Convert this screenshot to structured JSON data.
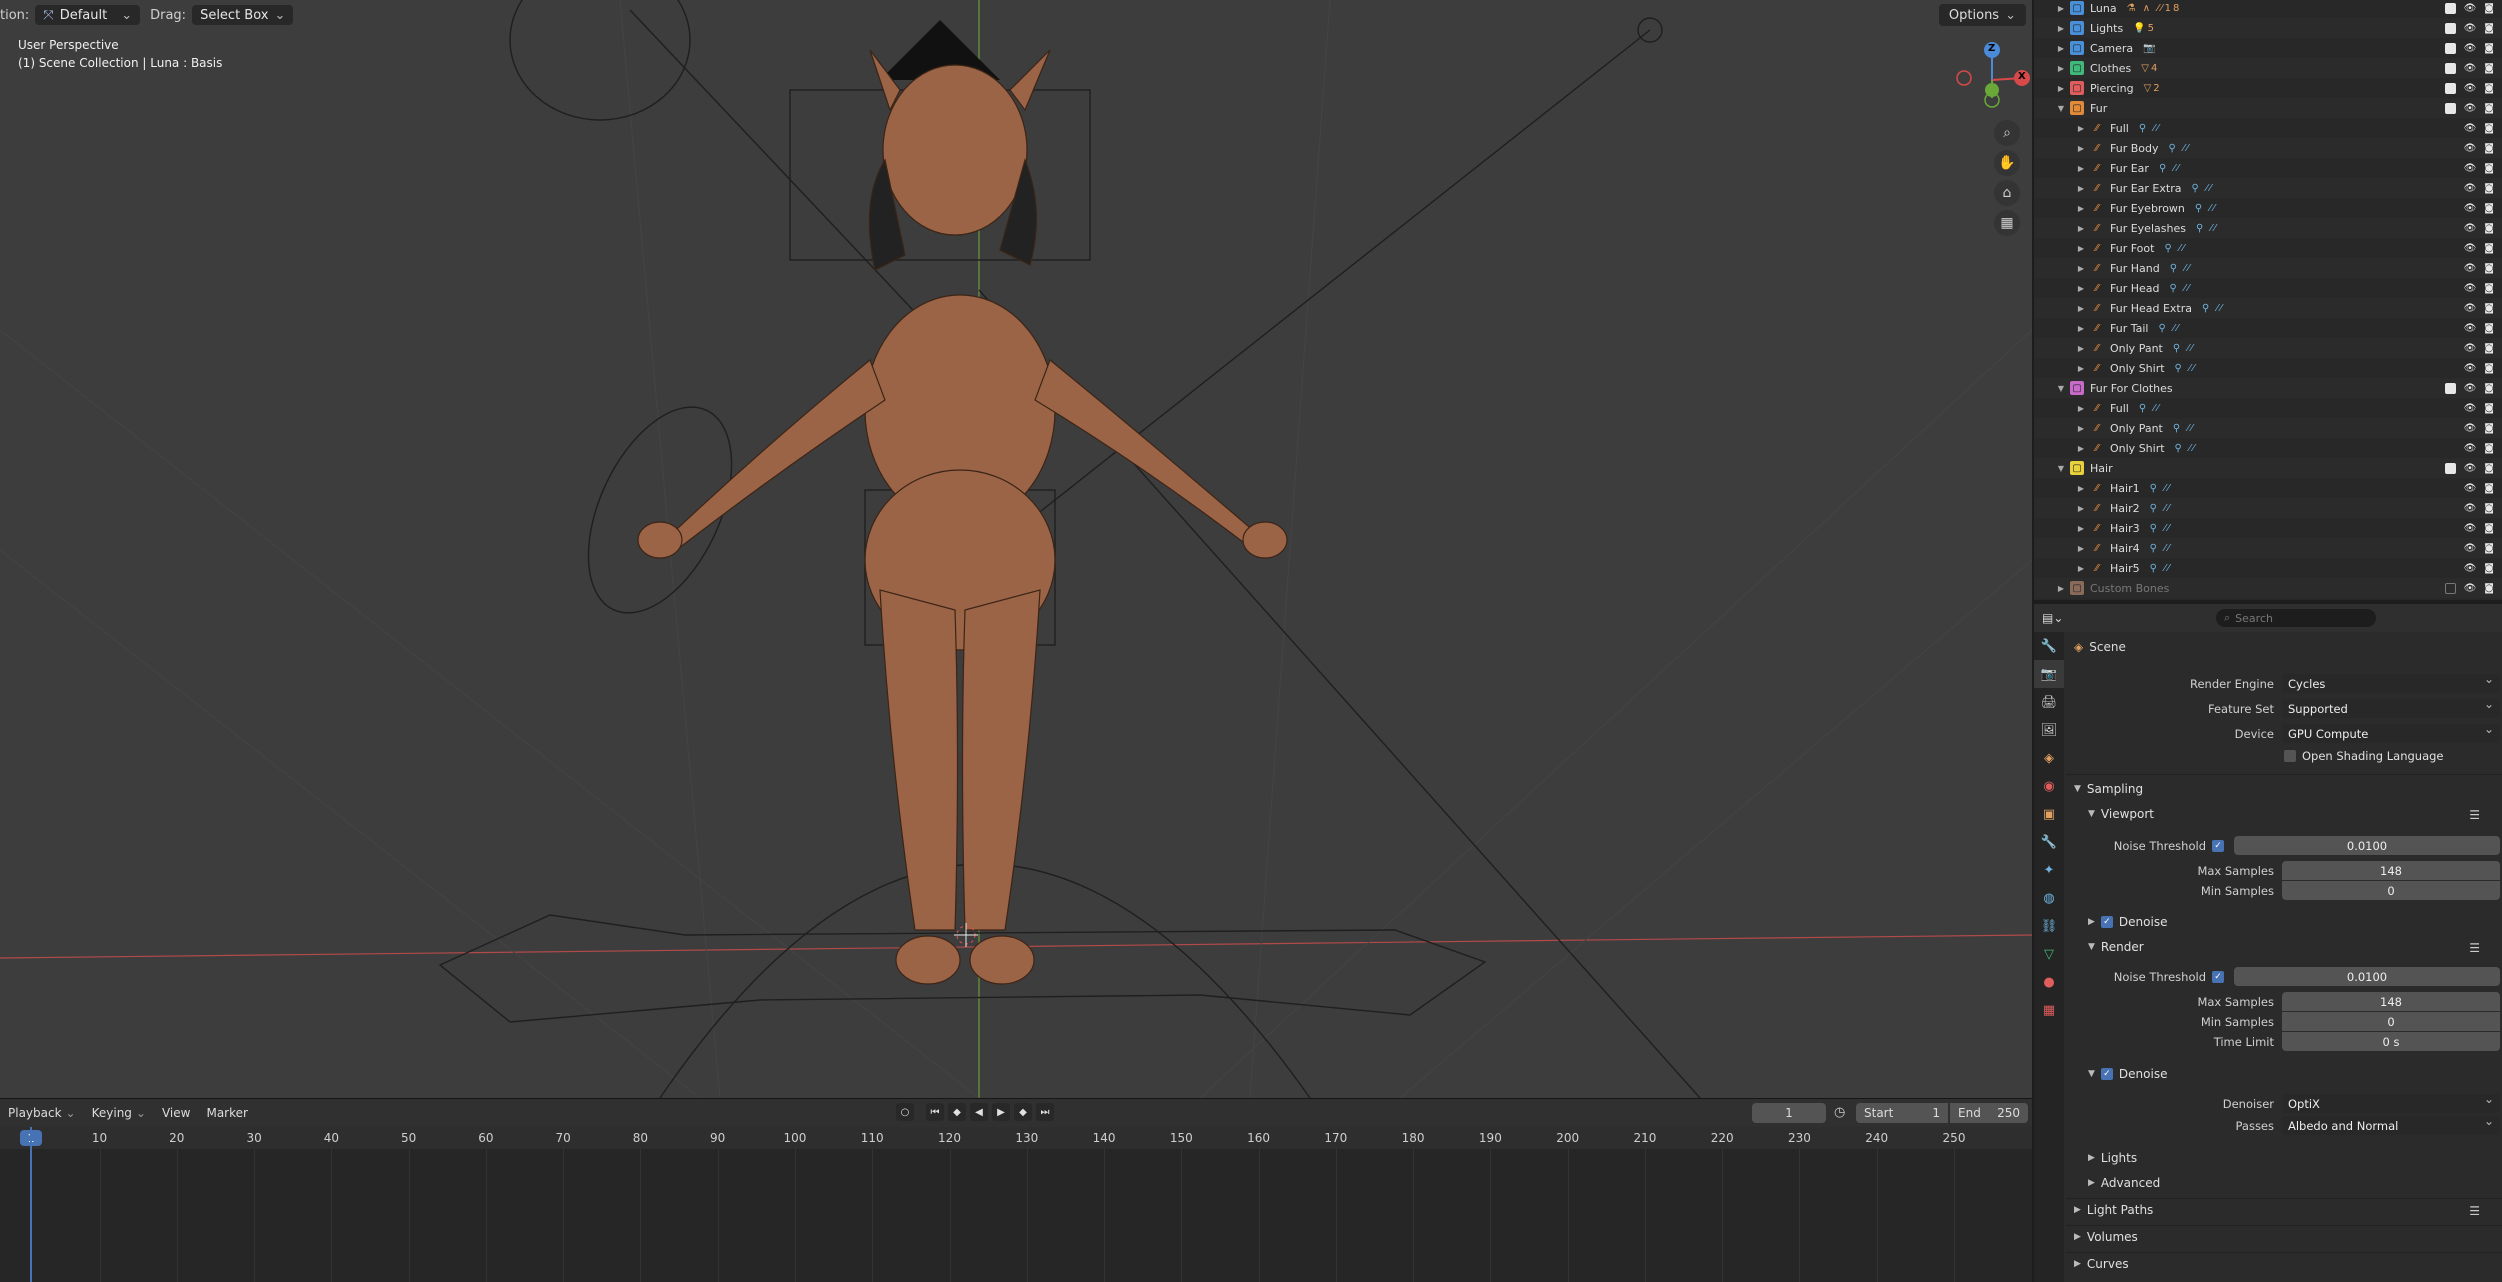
{
  "viewport": {
    "mode_label": "tion:",
    "mode_value": "Default",
    "drag_label": "Drag:",
    "drag_value": "Select Box",
    "options_label": "Options",
    "info_line1": "User Perspective",
    "info_line2": "(1) Scene Collection | Luna : Basis",
    "gizmo": {
      "z": "Z",
      "x": "X"
    },
    "nav_icons": [
      "zoom-icon",
      "hand-icon",
      "camera-icon",
      "grid-icon"
    ],
    "colors": {
      "bg": "#3d3d3d",
      "axis_x": "#b34a4a",
      "axis_y": "#6a9a3a",
      "skin": "#a06a4a"
    }
  },
  "timeline": {
    "menus": [
      "Playback",
      "Keying",
      "View",
      "Marker"
    ],
    "current_frame": "1",
    "frame_field": "1",
    "start_label": "Start",
    "start_value": "1",
    "end_label": "End",
    "end_value": "250",
    "ticks": [
      "1",
      "10",
      "20",
      "30",
      "40",
      "50",
      "60",
      "70",
      "80",
      "90",
      "100",
      "110",
      "120",
      "130",
      "140",
      "150",
      "160",
      "170",
      "180",
      "190",
      "200",
      "210",
      "220",
      "230",
      "240",
      "250"
    ]
  },
  "outliner": {
    "rows": [
      {
        "label": "Luna",
        "extra": "⚗ ∧ ⁄⁄18",
        "color": "#4a90d9",
        "indent": 0,
        "top": "collection"
      },
      {
        "label": "Lights",
        "extra": "💡5",
        "color": "#4a90d9",
        "indent": 0
      },
      {
        "label": "Camera",
        "extra": "📷",
        "color": "#4a90d9",
        "indent": 0
      },
      {
        "label": "Clothes",
        "extra": "▽4",
        "color": "#3fb87a",
        "indent": 0
      },
      {
        "label": "Piercing",
        "extra": "▽2",
        "color": "#e05d5d",
        "indent": 0
      },
      {
        "label": "Fur",
        "extra": "",
        "color": "#e08a3a",
        "indent": 0,
        "open": true
      },
      {
        "label": "Full",
        "extra": "",
        "indent": 1
      },
      {
        "label": "Fur Body",
        "extra": "",
        "indent": 1
      },
      {
        "label": "Fur Ear",
        "extra": "",
        "indent": 1
      },
      {
        "label": "Fur Ear Extra",
        "extra": "",
        "indent": 1
      },
      {
        "label": "Fur Eyebrown",
        "extra": "",
        "indent": 1
      },
      {
        "label": "Fur Eyelashes",
        "extra": "",
        "indent": 1
      },
      {
        "label": "Fur Foot",
        "extra": "",
        "indent": 1
      },
      {
        "label": "Fur Hand",
        "extra": "",
        "indent": 1
      },
      {
        "label": "Fur Head",
        "extra": "",
        "indent": 1
      },
      {
        "label": "Fur Head Extra",
        "extra": "",
        "indent": 1
      },
      {
        "label": "Fur Tail",
        "extra": "",
        "indent": 1
      },
      {
        "label": "Only Pant",
        "extra": "",
        "indent": 1
      },
      {
        "label": "Only Shirt",
        "extra": "",
        "indent": 1
      },
      {
        "label": "Fur For Clothes",
        "extra": "",
        "color": "#c86ac8",
        "indent": 0,
        "open": true
      },
      {
        "label": "Full",
        "extra": "",
        "indent": 1
      },
      {
        "label": "Only Pant",
        "extra": "",
        "indent": 1
      },
      {
        "label": "Only Shirt",
        "extra": "",
        "indent": 1
      },
      {
        "label": "Hair",
        "extra": "",
        "color": "#e8d13a",
        "indent": 0,
        "open": true
      },
      {
        "label": "Hair1",
        "extra": "",
        "indent": 1
      },
      {
        "label": "Hair2",
        "extra": "",
        "indent": 1
      },
      {
        "label": "Hair3",
        "extra": "",
        "indent": 1
      },
      {
        "label": "Hair4",
        "extra": "",
        "indent": 1
      },
      {
        "label": "Hair5",
        "extra": "",
        "indent": 1
      },
      {
        "label": "Custom Bones",
        "extra": "",
        "color": "#8a6a5a",
        "indent": 0,
        "dim": true
      }
    ]
  },
  "properties": {
    "search_placeholder": "Search",
    "scene_label": "Scene",
    "render_engine_label": "Render Engine",
    "render_engine_value": "Cycles",
    "feature_set_label": "Feature Set",
    "feature_set_value": "Supported",
    "device_label": "Device",
    "device_value": "GPU Compute",
    "osl_label": "Open Shading Language",
    "sampling_label": "Sampling",
    "viewport_label": "Viewport",
    "vp_noise_label": "Noise Threshold",
    "vp_noise_value": "0.0100",
    "vp_max_label": "Max Samples",
    "vp_max_value": "148",
    "vp_min_label": "Min Samples",
    "vp_min_value": "0",
    "vp_denoise_label": "Denoise",
    "render_label": "Render",
    "r_noise_label": "Noise Threshold",
    "r_noise_value": "0.0100",
    "r_max_label": "Max Samples",
    "r_max_value": "148",
    "r_min_label": "Min Samples",
    "r_min_value": "0",
    "r_time_label": "Time Limit",
    "r_time_value": "0 s",
    "r_denoise_label": "Denoise",
    "denoiser_label": "Denoiser",
    "denoiser_value": "OptiX",
    "passes_label": "Passes",
    "passes_value": "Albedo and Normal",
    "lights_label": "Lights",
    "advanced_label": "Advanced",
    "light_paths_label": "Light Paths",
    "volumes_label": "Volumes",
    "curves_label": "Curves",
    "tab_icons": [
      "tool-icon",
      "render-icon",
      "output-icon",
      "view-layer-icon",
      "scene-icon",
      "world-icon",
      "object-icon",
      "modifier-icon",
      "particles-icon",
      "physics-icon",
      "constraints-icon",
      "data-icon",
      "material-icon",
      "texture-icon"
    ]
  }
}
